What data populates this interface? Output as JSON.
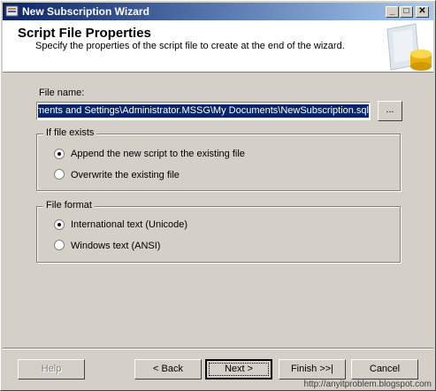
{
  "window": {
    "title": "New Subscription Wizard"
  },
  "header": {
    "title": "Script File Properties",
    "subtitle": "Specify the properties of the script file to create at the end of the wizard."
  },
  "file_name": {
    "label": "File name:",
    "value": "C:\\Documents and Settings\\Administrator.MSSG\\My Documents\\NewSubscription.sql",
    "browse_label": "..."
  },
  "if_file_exists": {
    "title": "If file exists",
    "options": [
      {
        "label": "Append the new script to the existing file",
        "selected": true
      },
      {
        "label": "Overwrite the existing file",
        "selected": false
      }
    ]
  },
  "file_format": {
    "title": "File format",
    "options": [
      {
        "label": "International text (Unicode)",
        "selected": true
      },
      {
        "label": "Windows text (ANSI)",
        "selected": false
      }
    ]
  },
  "buttons": {
    "help": "Help",
    "back": "< Back",
    "next": "Next >",
    "finish": "Finish >>|",
    "cancel": "Cancel"
  },
  "watermark": "http://anyitproblem.blogspot.com"
}
